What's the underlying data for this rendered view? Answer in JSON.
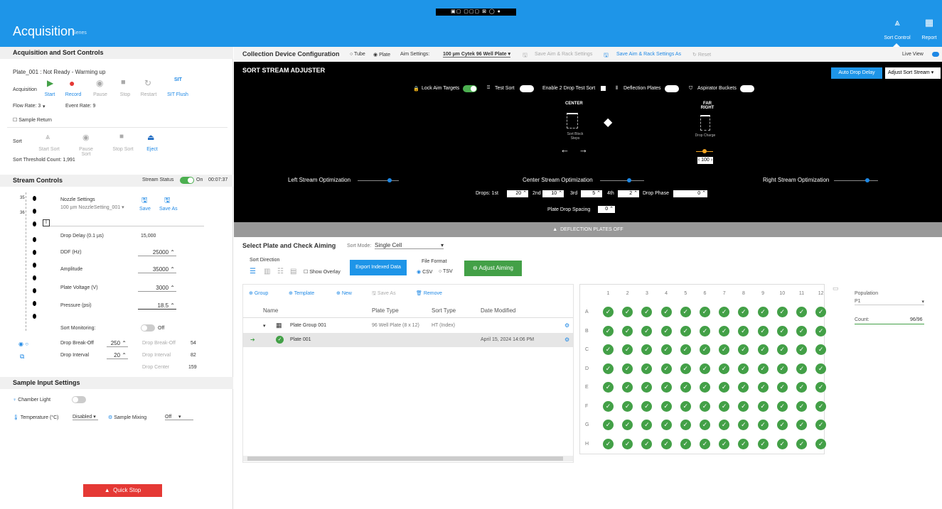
{
  "app": {
    "title": "Acquisition",
    "subtitle": "Series",
    "toolstrip": "▣▢ ▢▢▢ ⊠ ◯ ●"
  },
  "nav": {
    "sort_control": "Sort Control",
    "report": "Report"
  },
  "acq": {
    "header": "Acquisition and Sort Controls",
    "status": "Plate_001 : Not Ready - Warming up",
    "acq_label": "Acquisition",
    "buttons": {
      "start": "Start",
      "record": "Record",
      "pause": "Pause",
      "stop": "Stop",
      "restart": "Restart",
      "sit_flush": "SIT Flush",
      "sit_icon": "SIT"
    },
    "flow_rate": "Flow Rate: 3",
    "event_rate": "Event Rate: 9",
    "sample_return": "Sample Return",
    "sort_label": "Sort",
    "sort_buttons": {
      "start_sort": "Start Sort",
      "pause_sort": "Pause Sort",
      "stop_sort": "Stop Sort",
      "eject": "Eject"
    },
    "threshold": "Sort Threshold Count: 1,991"
  },
  "stream": {
    "header": "Stream Controls",
    "status_label": "Stream Status",
    "on_label": "On",
    "timer": "00:07:37",
    "nozzle_label": "Nozzle Settings",
    "nozzle_value": "100 µm NozzleSetting_001",
    "save": "Save",
    "save_as": "Save As",
    "drop_delay_label": "Drop Delay (0.1 µs)",
    "drop_delay": "15,000",
    "ddf_label": "DDF (Hz)",
    "ddf": "25000",
    "amplitude_label": "Amplitude",
    "amplitude": "35000",
    "plate_voltage_label": "Plate Voltage (V)",
    "plate_voltage": "3000",
    "pressure_label": "Pressure (psi)",
    "pressure": "18.5",
    "sort_monitoring": "Sort Monitoring:",
    "off": "Off",
    "drop_breakoff_label": "Drop Break-Off",
    "drop_breakoff": "250",
    "drop_interval_label": "Drop Interval",
    "drop_interval": "20",
    "drop_breakoff_r_label": "Drop Break-Off",
    "drop_breakoff_r": "54",
    "drop_interval_r_label": "Drop Interval",
    "drop_interval_r": "82",
    "drop_center_label": "Drop Center",
    "drop_center": "159",
    "side_a": "35",
    "side_b": "36"
  },
  "sample": {
    "header": "Sample Input Settings",
    "chamber_light": "Chamber Light",
    "temperature_label": "Temperature (°C)",
    "temperature": "Disabled",
    "mixing_label": "Sample Mixing",
    "mixing": "Off"
  },
  "quick_stop": "Quick Stop",
  "cdc": {
    "title": "Collection Device Configuration",
    "tube": "Tube",
    "plate": "Plate",
    "aim_label": "Aim Settings:",
    "aim_value": "100 µm Cytek 96 Well Plate",
    "save_aim": "Save Aim & Rack Settings",
    "save_aim_as": "Save Aim & Rack Settings As",
    "reset": "Reset",
    "live_view": "Live View"
  },
  "ssa": {
    "title": "SORT STREAM ADJUSTER",
    "lock": "Lock Aim Targets",
    "test_sort": "Test Sort",
    "enable2": "Enable 2 Drop Test Sort",
    "deflection": "Deflection Plates",
    "aspirator": "Aspirator Buckets",
    "auto_drop": "Auto Drop Delay",
    "adjust": "Adjust Sort Stream",
    "center": "CENTER",
    "far_right": "FAR RIGHT",
    "sort_block": "Sort Block Steps",
    "drop_charge": "Drop Charge",
    "charge_value": "‹ 100 ›",
    "left_opt": "Left Stream Optimization",
    "center_opt": "Center Stream Optimization",
    "right_opt": "Right Stream Optimization",
    "drops_label": "Drops: 1st",
    "d1": "20",
    "d2_label": "2nd",
    "d2": "10",
    "d3_label": "3rd",
    "d3": "5",
    "d4_label": "4th",
    "d4": "2",
    "phase_label": "Drop Phase",
    "phase": "0",
    "spacing_label": "Plate Drop Spacing",
    "spacing": "0",
    "deflection_off": "DEFLECTION PLATES OFF"
  },
  "plate": {
    "title": "Select Plate and Check Aiming",
    "sort_mode_label": "Sort Mode:",
    "sort_mode": "Single Cell",
    "sort_direction": "Sort Direction",
    "show_overlay": "Show Overlay",
    "export": "Export Indexed Data",
    "file_format": "File Format",
    "csv": "CSV",
    "tsv": "TSV",
    "adjust_aiming": "Adjust Aiming",
    "tools": {
      "group": "Group",
      "template": "Template",
      "new": "New",
      "save_as": "Save As",
      "remove": "Remove"
    },
    "columns": [
      "Name",
      "Plate Type",
      "Sort Type",
      "Date Modified"
    ],
    "rows": [
      {
        "name": "Plate Group 001",
        "type": "96 Well Plate (8 x 12)",
        "sort": "HT (Index)",
        "date": ""
      },
      {
        "name": "Plate 001",
        "type": "",
        "sort": "",
        "date": "April 15, 2024 14:06 PM"
      }
    ],
    "col_numbers": [
      "1",
      "2",
      "3",
      "4",
      "5",
      "6",
      "7",
      "8",
      "9",
      "10",
      "11",
      "12"
    ],
    "row_letters": [
      "A",
      "B",
      "C",
      "D",
      "E",
      "F",
      "G",
      "H"
    ],
    "population_label": "Population",
    "population": "P1",
    "count_label": "Count:",
    "count": "96/96"
  }
}
